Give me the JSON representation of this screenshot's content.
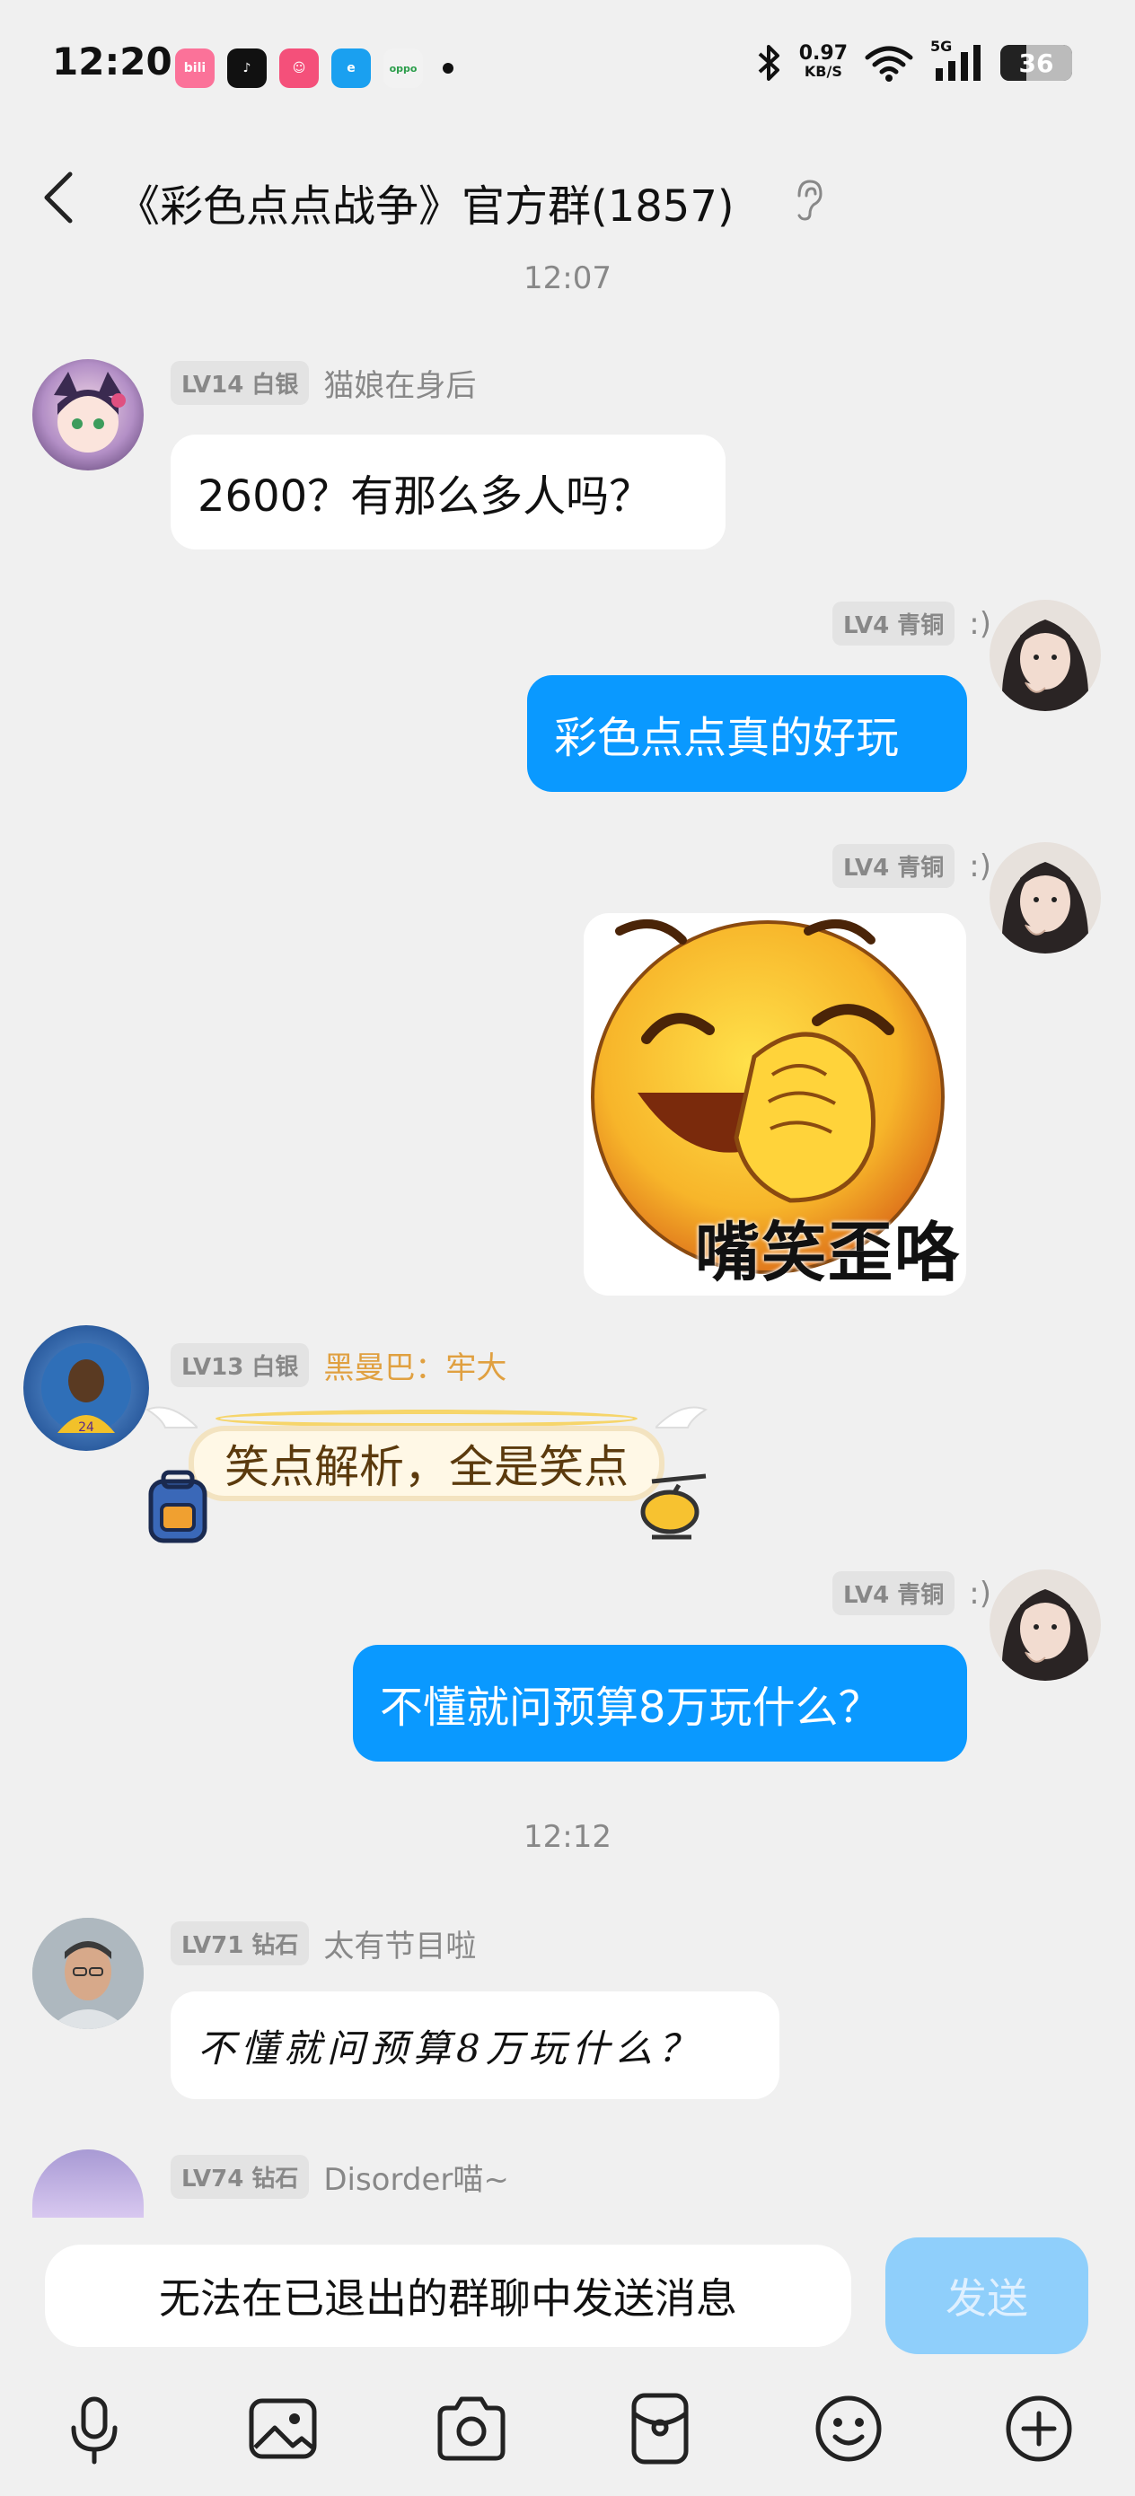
{
  "status_bar": {
    "time": "12:20",
    "net_speed_value": "0.97",
    "net_speed_unit": "KB/S",
    "network": "5G",
    "battery": "36",
    "app_icons": [
      "bilibili-icon",
      "tiktok-icon",
      "pink-app-icon",
      "blue-app-icon",
      "oppo-app-icon"
    ]
  },
  "header": {
    "title": "《彩色点点战争》官方群(1857)"
  },
  "messages": {
    "time1": "12:07",
    "m1": {
      "badge": "LV14 白银",
      "nick": "猫娘在身后",
      "text": "2600？有那么多人吗？"
    },
    "m2": {
      "badge": "LV4 青铜",
      "nick": ":)",
      "text": "彩色点点真的好玩"
    },
    "m3": {
      "badge": "LV4 青铜",
      "nick": ":)",
      "sticker_text": "嘴笑歪咯"
    },
    "m4": {
      "badge": "LV13 白银",
      "nick": "黑曼巴：牢大",
      "text": "笑点解析，全是笑点"
    },
    "m5": {
      "badge": "LV4 青铜",
      "nick": ":)",
      "text": "不懂就问预算8万玩什么？"
    },
    "time2": "12:12",
    "m6": {
      "badge": "LV71 钻石",
      "nick": "太有节目啦",
      "text": "不懂就问预算8万玩什么？"
    },
    "m7": {
      "badge": "LV74 钻石",
      "nick": "Disorder喵~"
    }
  },
  "input": {
    "placeholder": "无法在已退出的群聊中发送消息",
    "send_label": "发送"
  },
  "colors": {
    "accent_blue": "#0a99ff",
    "send_disabled": "#8fcffb"
  }
}
